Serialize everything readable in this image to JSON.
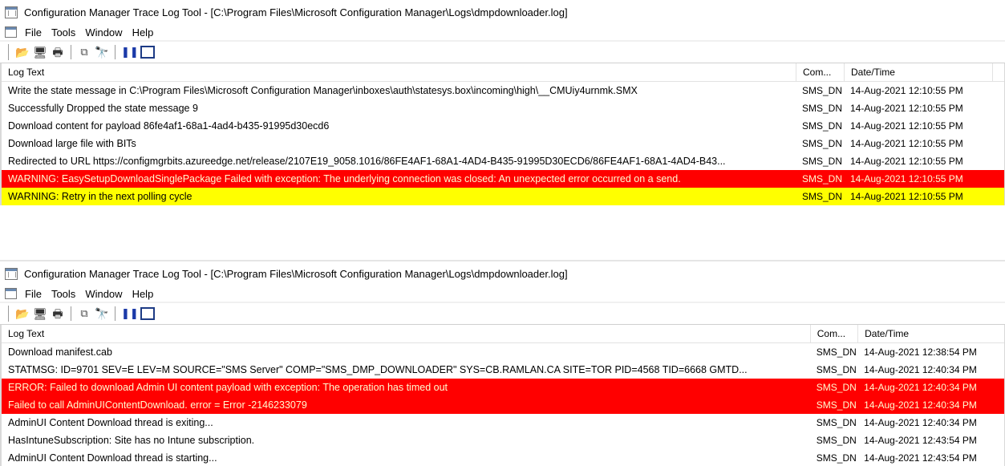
{
  "windows": [
    {
      "title": "Configuration Manager Trace Log Tool - [C:\\Program Files\\Microsoft Configuration Manager\\Logs\\dmpdownloader.log]",
      "menu": [
        "File",
        "Tools",
        "Window",
        "Help"
      ],
      "columns": {
        "text": "Log Text",
        "component": "Com...",
        "datetime": "Date/Time"
      },
      "rows": [
        {
          "text": "Write the state message in C:\\Program Files\\Microsoft Configuration Manager\\inboxes\\auth\\statesys.box\\incoming\\high\\__CMUiy4urnmk.SMX",
          "component": "SMS_DN",
          "datetime": "14-Aug-2021 12:10:55 PM",
          "level": "normal"
        },
        {
          "text": "Successfully Dropped the state message 9",
          "component": "SMS_DN",
          "datetime": "14-Aug-2021 12:10:55 PM",
          "level": "normal"
        },
        {
          "text": "Download content for payload 86fe4af1-68a1-4ad4-b435-91995d30ecd6",
          "component": "SMS_DN",
          "datetime": "14-Aug-2021 12:10:55 PM",
          "level": "normal"
        },
        {
          "text": "Download large file with BITs",
          "component": "SMS_DN",
          "datetime": "14-Aug-2021 12:10:55 PM",
          "level": "normal"
        },
        {
          "text": "Redirected to URL https://configmgrbits.azureedge.net/release/2107E19_9058.1016/86FE4AF1-68A1-4AD4-B435-91995D30ECD6/86FE4AF1-68A1-4AD4-B43...",
          "component": "SMS_DN",
          "datetime": "14-Aug-2021 12:10:55 PM",
          "level": "normal"
        },
        {
          "text": "WARNING: EasySetupDownloadSinglePackage Failed with exception: The underlying connection was closed: An unexpected error occurred on a send.",
          "component": "SMS_DN",
          "datetime": "14-Aug-2021 12:10:55 PM",
          "level": "error"
        },
        {
          "text": "WARNING: Retry in the next polling cycle",
          "component": "SMS_DN",
          "datetime": "14-Aug-2021 12:10:55 PM",
          "level": "warning"
        }
      ]
    },
    {
      "title": "Configuration Manager Trace Log Tool - [C:\\Program Files\\Microsoft Configuration Manager\\Logs\\dmpdownloader.log]",
      "menu": [
        "File",
        "Tools",
        "Window",
        "Help"
      ],
      "columns": {
        "text": "Log Text",
        "component": "Com...",
        "datetime": "Date/Time"
      },
      "rows": [
        {
          "text": "Download manifest.cab",
          "component": "SMS_DN",
          "datetime": "14-Aug-2021 12:38:54 PM",
          "level": "normal"
        },
        {
          "text": "STATMSG: ID=9701 SEV=E LEV=M SOURCE=\"SMS Server\" COMP=\"SMS_DMP_DOWNLOADER\" SYS=CB.RAMLAN.CA SITE=TOR PID=4568 TID=6668 GMTD...",
          "component": "SMS_DN",
          "datetime": "14-Aug-2021 12:40:34 PM",
          "level": "normal"
        },
        {
          "text": "ERROR: Failed to download Admin UI content payload with exception: The operation has timed out",
          "component": "SMS_DN",
          "datetime": "14-Aug-2021 12:40:34 PM",
          "level": "error"
        },
        {
          "text": "Failed to call AdminUIContentDownload. error = Error -2146233079",
          "component": "SMS_DN",
          "datetime": "14-Aug-2021 12:40:34 PM",
          "level": "error"
        },
        {
          "text": "AdminUI Content Download thread is exiting...",
          "component": "SMS_DN",
          "datetime": "14-Aug-2021 12:40:34 PM",
          "level": "normal"
        },
        {
          "text": "HasIntuneSubscription: Site has no Intune subscription.",
          "component": "SMS_DN",
          "datetime": "14-Aug-2021 12:43:54 PM",
          "level": "normal"
        },
        {
          "text": "AdminUI Content Download thread is starting...",
          "component": "SMS_DN",
          "datetime": "14-Aug-2021 12:43:54 PM",
          "level": "normal"
        }
      ]
    }
  ],
  "toolbar_icons": [
    "open-icon",
    "print-preview-icon",
    "print-icon",
    "copy-icon",
    "find-icon",
    "pause-icon",
    "window-icon"
  ],
  "colors": {
    "error_bg": "#ff0000",
    "error_text": "#fffbd0",
    "warning_bg": "#ffff00"
  }
}
